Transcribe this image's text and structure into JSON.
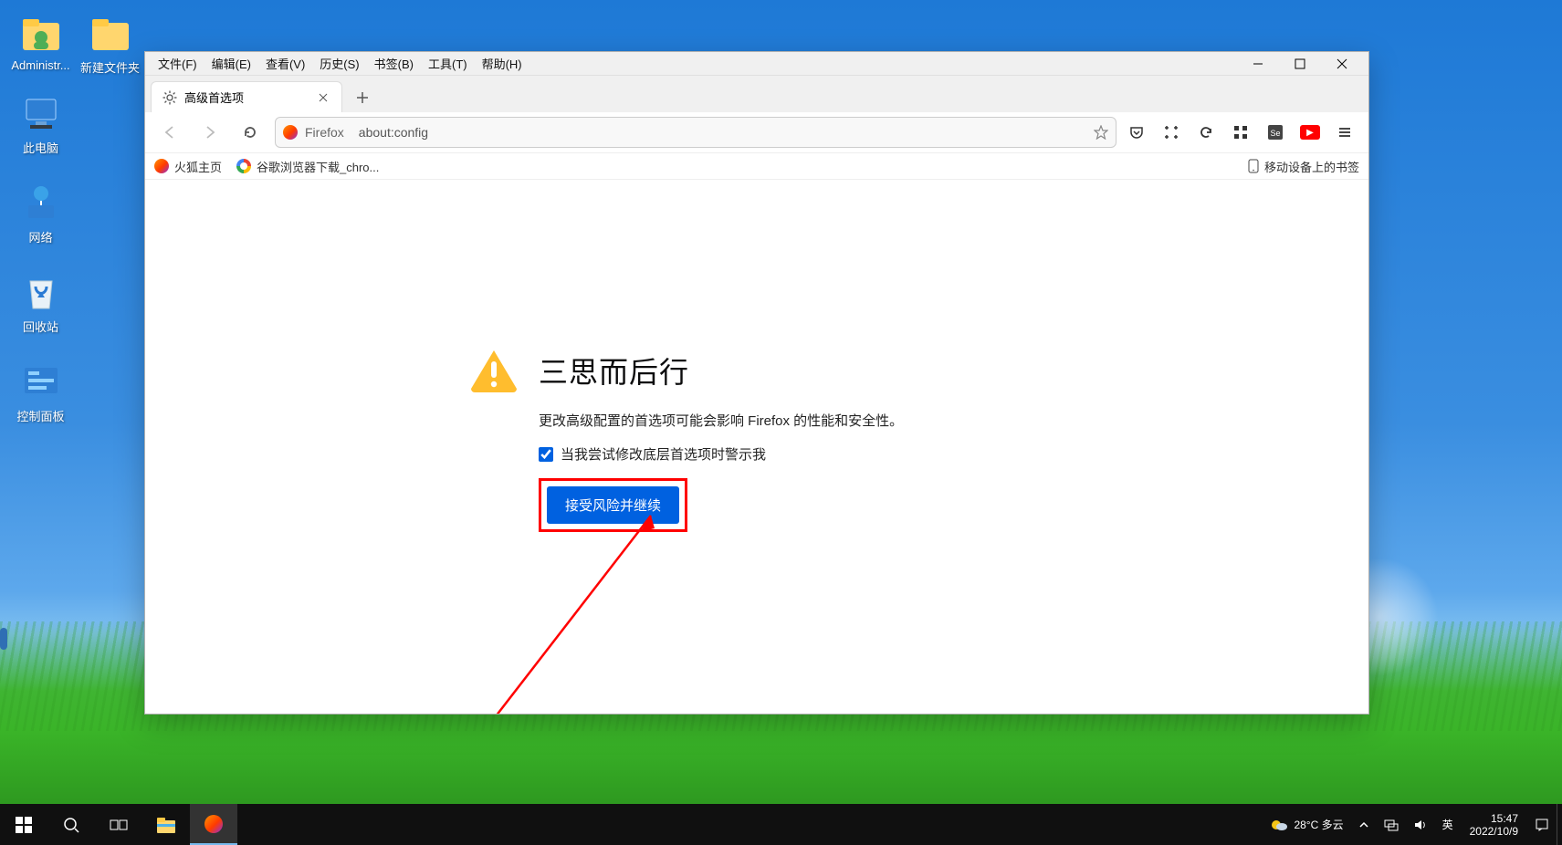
{
  "desktop": {
    "icons": [
      {
        "label": "Administr..."
      },
      {
        "label": "新建文件夹"
      },
      {
        "label": "此电脑"
      },
      {
        "label": "网络"
      },
      {
        "label": "回收站"
      },
      {
        "label": "控制面板"
      }
    ]
  },
  "firefox": {
    "menus": [
      "文件(F)",
      "编辑(E)",
      "查看(V)",
      "历史(S)",
      "书签(B)",
      "工具(T)",
      "帮助(H)"
    ],
    "tab_title": "高级首选项",
    "addr_label": "Firefox",
    "addr_url": "about:config",
    "bookmarks": {
      "a": "火狐主页",
      "b": "谷歌浏览器下载_chro...",
      "right": "移动设备上的书签"
    },
    "page": {
      "heading": "三思而后行",
      "subtext": "更改高级配置的首选项可能会影响 Firefox 的性能和安全性。",
      "checkbox_label": "当我尝试修改底层首选项时警示我",
      "accept_button": "接受风险并继续"
    }
  },
  "taskbar": {
    "weather_temp": "28°C 多云",
    "ime": "英",
    "time": "15:47",
    "date": "2022/10/9"
  }
}
